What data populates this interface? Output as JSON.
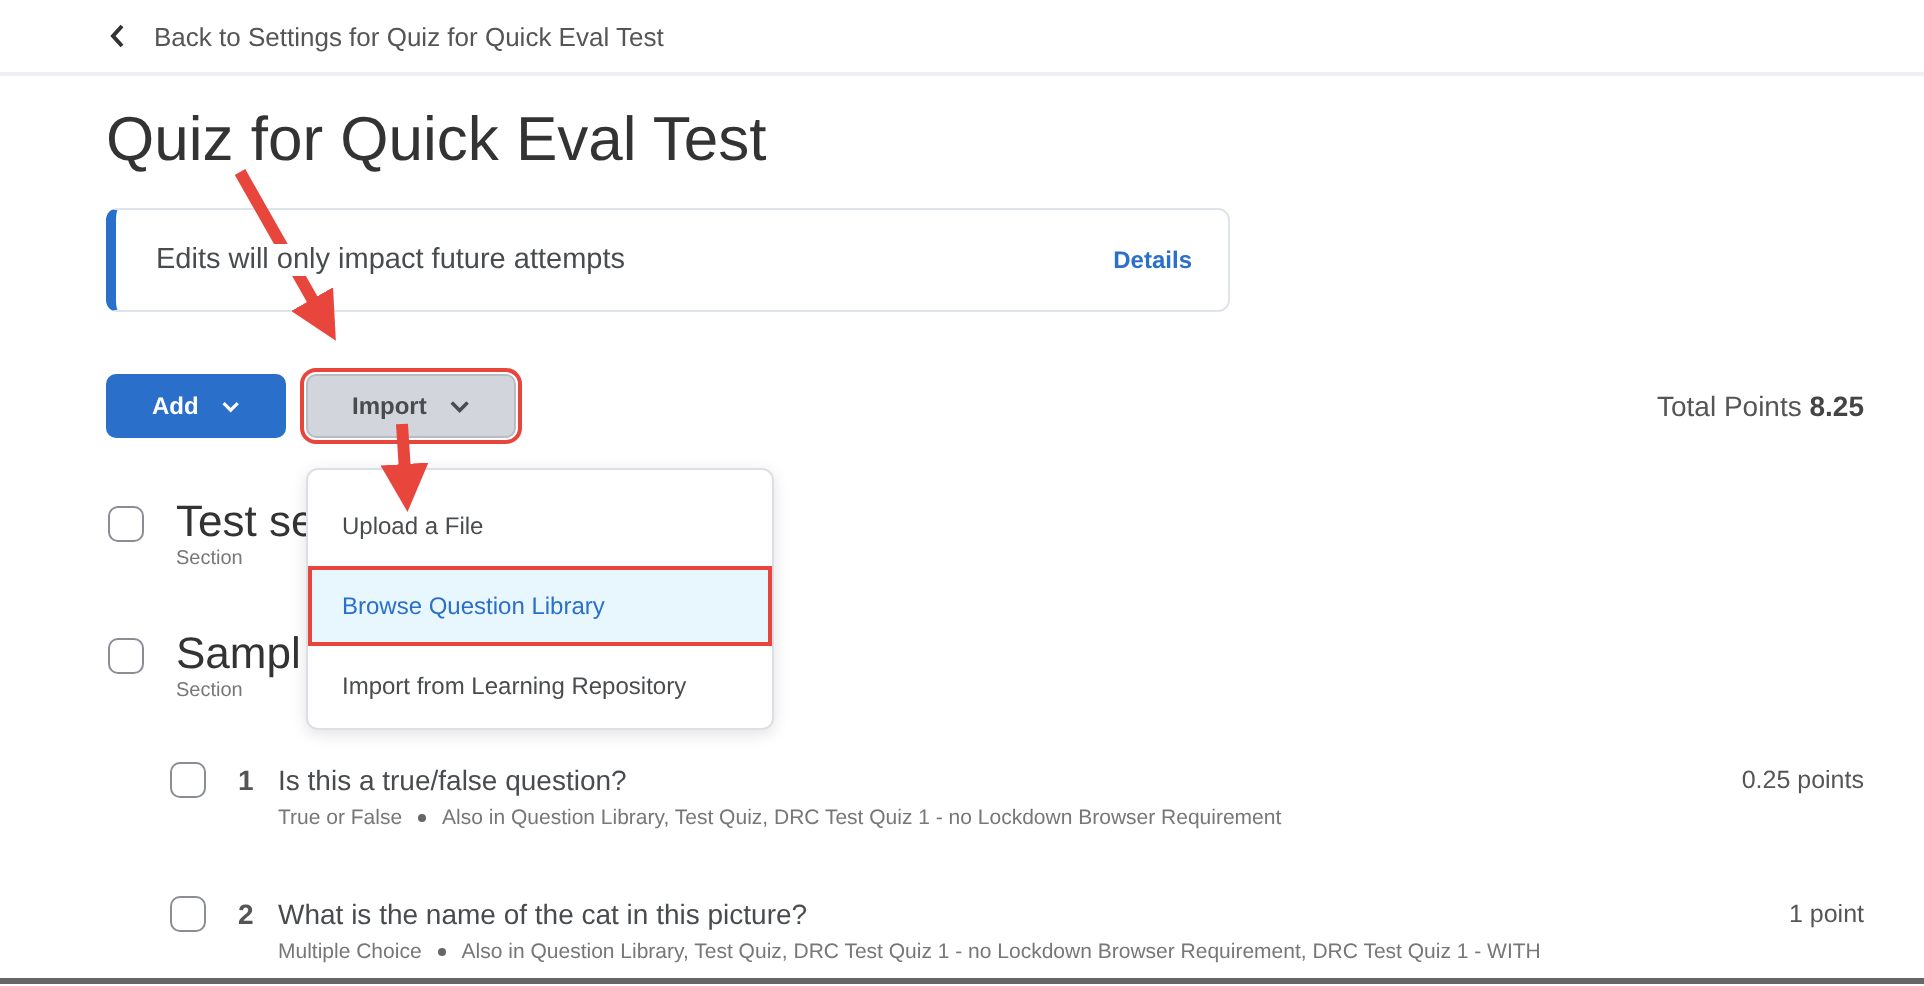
{
  "back_link": {
    "label": "Back to Settings for Quiz for Quick Eval Test"
  },
  "title": "Quiz for Quick Eval Test",
  "alert": {
    "message": "Edits will only impact future attempts",
    "link": "Details"
  },
  "toolbar": {
    "buttons": [
      {
        "label": "Add",
        "kind": "primary",
        "highlighted": false
      },
      {
        "label": "Import",
        "kind": "secondary",
        "highlighted": true
      }
    ],
    "total_label": "Total Points",
    "total_value": "8.25"
  },
  "import_menu": {
    "expanded": true,
    "items": [
      {
        "label": "Upload a File",
        "selected": false,
        "highlighted": false
      },
      {
        "label": "Browse Question Library",
        "selected": true,
        "highlighted": true
      },
      {
        "label": "Import from Learning Repository",
        "selected": false,
        "highlighted": false
      }
    ]
  },
  "sections": [
    {
      "title": "Test se",
      "subtitle": "Section",
      "checked": false
    },
    {
      "title": "Sampl",
      "subtitle": "Section",
      "checked": false
    }
  ],
  "questions": [
    {
      "number": "1",
      "text": "Is this a true/false question?",
      "type": "True or False",
      "also_in": "Also in Question Library, Test Quiz, DRC Test Quiz 1 - no Lockdown Browser Requirement",
      "points": "0.25 points",
      "checked": false
    },
    {
      "number": "2",
      "text": "What is the name of the cat in this picture?",
      "type": "Multiple Choice",
      "also_in": "Also in Question Library, Test Quiz, DRC Test Quiz 1 - no Lockdown Browser Requirement, DRC Test Quiz 1 - WITH",
      "points": "1 point",
      "checked": false
    }
  ]
}
